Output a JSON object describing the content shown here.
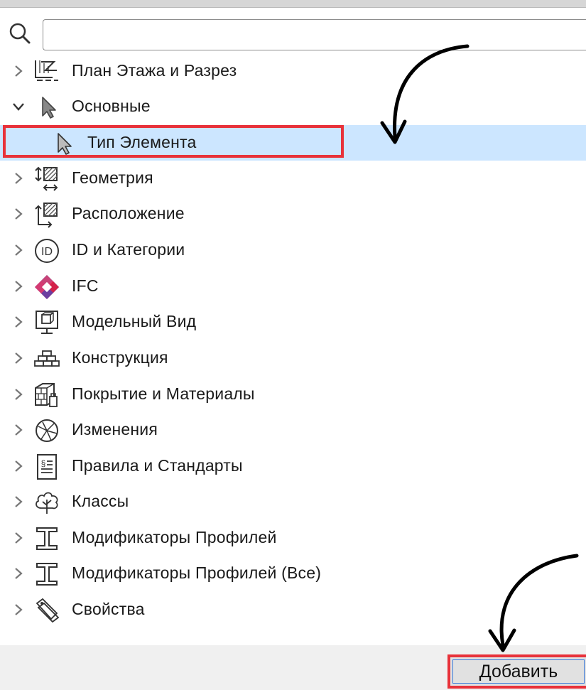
{
  "search": {
    "value": "",
    "placeholder": ""
  },
  "tree": [
    {
      "label": "План Этажа и Разрез",
      "icon": "floor-plan-section-icon",
      "expanded": false
    },
    {
      "label": "Основные",
      "icon": "cursor-arrow-icon",
      "expanded": true
    },
    {
      "label": "Тип Элемента",
      "icon": "cursor-arrow-icon",
      "child": true,
      "selected": true
    },
    {
      "label": "Геометрия",
      "icon": "geometry-icon",
      "expanded": false
    },
    {
      "label": "Расположение",
      "icon": "positioning-icon",
      "expanded": false
    },
    {
      "label": "ID и Категории",
      "icon": "id-icon",
      "expanded": false
    },
    {
      "label": "IFC",
      "icon": "ifc-logo-icon",
      "expanded": false
    },
    {
      "label": "Модельный Вид",
      "icon": "model-view-icon",
      "expanded": false
    },
    {
      "label": "Конструкция",
      "icon": "structure-icon",
      "expanded": false
    },
    {
      "label": "Покрытие и Материалы",
      "icon": "surfaces-materials-icon",
      "expanded": false
    },
    {
      "label": "Изменения",
      "icon": "changes-icon",
      "expanded": false
    },
    {
      "label": "Правила и Стандарты",
      "icon": "rules-standards-icon",
      "expanded": false
    },
    {
      "label": "Классы",
      "icon": "classes-tree-icon",
      "expanded": false
    },
    {
      "label": "Модификаторы Профилей",
      "icon": "profile-beam-icon",
      "expanded": false
    },
    {
      "label": "Модификаторы Профилей (Все)",
      "icon": "profile-beam-icon",
      "expanded": false
    },
    {
      "label": "Свойства",
      "icon": "properties-tag-icon",
      "expanded": false
    }
  ],
  "footer": {
    "add_label": "Добавить"
  },
  "colors": {
    "selection": "#cce6ff",
    "highlight": "#e8323a"
  }
}
